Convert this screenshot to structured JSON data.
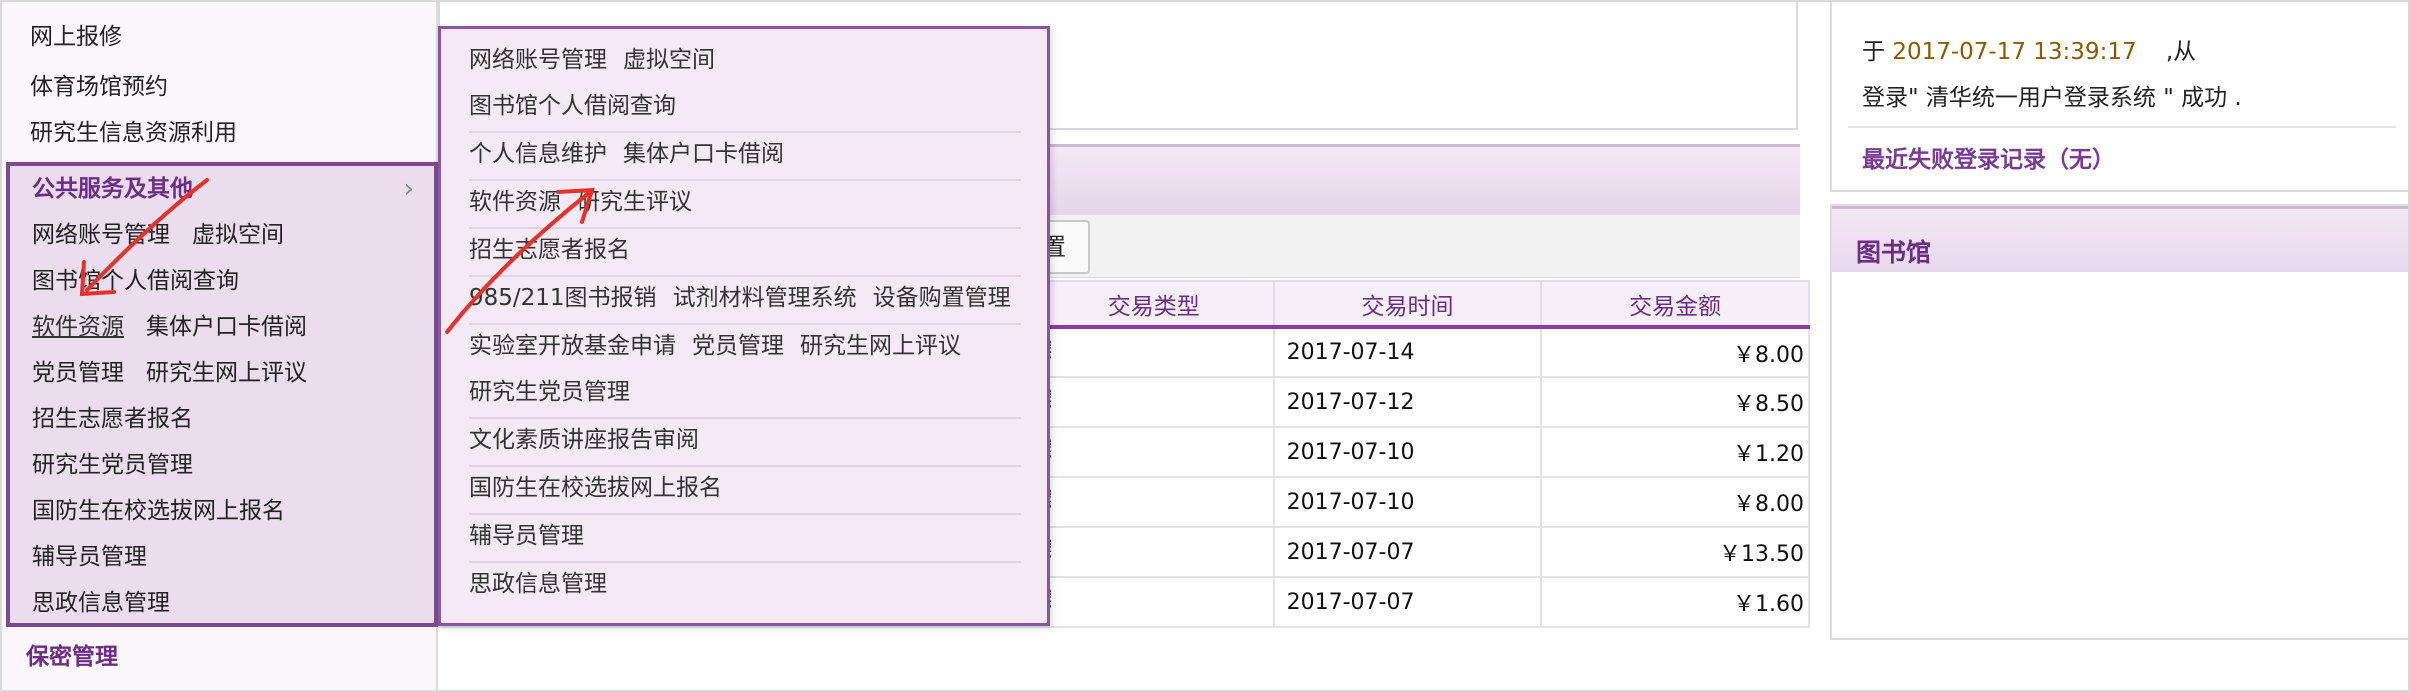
{
  "sidebar": {
    "top_items": [
      "网上报修",
      "体育场馆预约",
      "研究生信息资源利用"
    ],
    "group_title": "公共服务及其他",
    "group_rows": [
      [
        "网络账号管理",
        "虚拟空间"
      ],
      [
        "图书馆个人借阅查询"
      ],
      [
        "软件资源",
        "集体户口卡借阅"
      ],
      [
        "党员管理",
        "研究生网上评议"
      ],
      [
        "招生志愿者报名"
      ],
      [
        "研究生党员管理"
      ],
      [
        "国防生在校选拔网上报名"
      ],
      [
        "辅导员管理"
      ],
      [
        "思政信息管理"
      ]
    ],
    "next_section": "保密管理"
  },
  "popup": {
    "rows": [
      [
        "网络账号管理",
        "虚拟空间"
      ],
      [
        "图书馆个人借阅查询"
      ],
      [
        "个人信息维护",
        "集体户口卡借阅"
      ],
      [
        "软件资源",
        "研究生评议"
      ],
      [
        "招生志愿者报名"
      ],
      [
        "985/211图书报销",
        "试剂材料管理系统",
        "设备购置管理"
      ],
      [
        "实验室开放基金申请",
        "党员管理",
        "研究生网上评议"
      ],
      [
        "研究生党员管理"
      ],
      [
        "文化素质讲座报告审阅"
      ],
      [
        "国防生在校选拔网上报名"
      ],
      [
        "辅导员管理"
      ],
      [
        "思政信息管理"
      ]
    ]
  },
  "toolbar": {
    "button_label": "置"
  },
  "table": {
    "headers": [
      "交易类型",
      "交易时间",
      "交易金额"
    ],
    "rows": [
      {
        "type": "费",
        "time": "2017-07-14",
        "amount": "￥8.00"
      },
      {
        "type": "费",
        "time": "2017-07-12",
        "amount": "￥8.50"
      },
      {
        "type": "费",
        "time": "2017-07-10",
        "amount": "￥1.20"
      },
      {
        "type": "费",
        "time": "2017-07-10",
        "amount": "￥8.00"
      },
      {
        "type": "费",
        "time": "2017-07-07",
        "amount": "￥13.50"
      },
      {
        "type": "费",
        "time": "2017-07-07",
        "amount": "￥1.60"
      }
    ]
  },
  "login": {
    "prefix": "于",
    "datetime": "2017-07-17 13:39:17",
    "suffix": ",从",
    "line2": "登录\" 清华统一用户登录系统 \" 成功 .",
    "failed_link": "最近失败登录记录（无）"
  },
  "library": {
    "title": "图书馆"
  },
  "colors": {
    "accent": "#6d2c86",
    "menu_bg": "#f4eaf6",
    "annotation_arrow": "#e8312a"
  },
  "icons": {
    "group_chevron": "chevron-right-icon"
  }
}
